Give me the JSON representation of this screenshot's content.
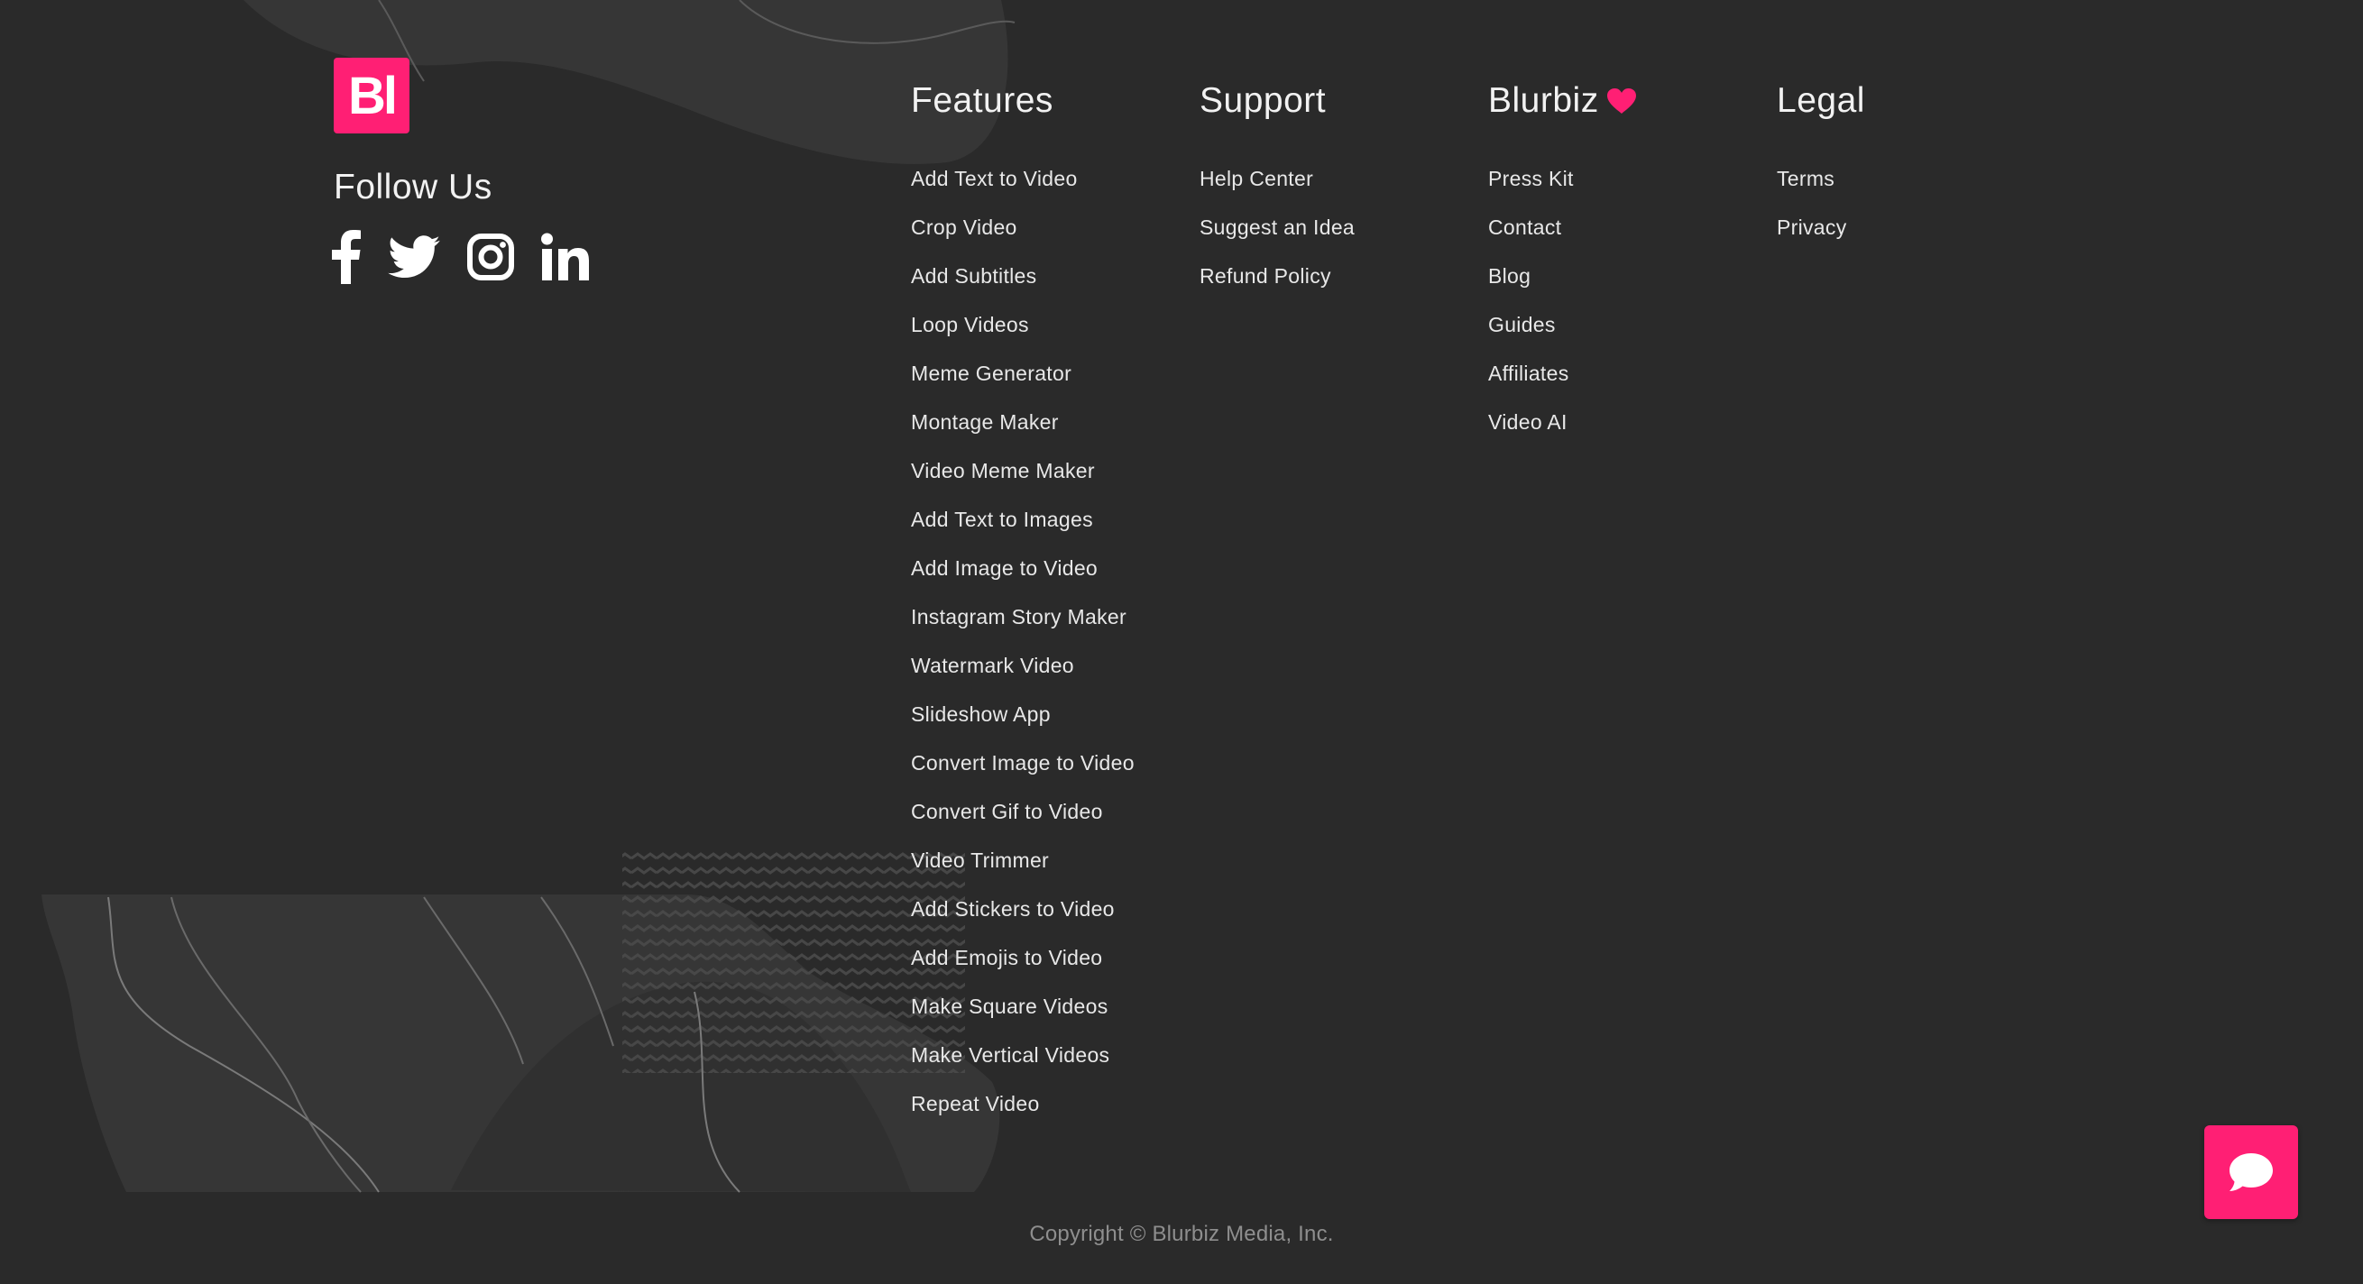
{
  "brand": {
    "logo_text": "Bl",
    "accent": "#ff1f74"
  },
  "follow": {
    "title": "Follow Us",
    "icons": [
      "facebook-icon",
      "twitter-icon",
      "instagram-icon",
      "linkedin-icon"
    ]
  },
  "columns": [
    {
      "title": "Features",
      "links": [
        "Add Text to Video",
        "Crop Video",
        "Add Subtitles",
        "Loop Videos",
        "Meme Generator",
        "Montage Maker",
        "Video Meme Maker",
        "Add Text to Images",
        "Add Image to Video",
        "Instagram Story Maker",
        "Watermark Video",
        "Slideshow App",
        "Convert Image to Video",
        "Convert Gif to Video",
        "Video Trimmer",
        "Add Stickers to Video",
        "Add Emojis to Video",
        "Make Square Videos",
        "Make Vertical Videos",
        "Repeat Video"
      ]
    },
    {
      "title": "Support",
      "links": [
        "Help Center",
        "Suggest an Idea",
        "Refund Policy"
      ]
    },
    {
      "title": "Blurbiz",
      "title_icon": "heart-icon",
      "links": [
        "Press Kit",
        "Contact",
        "Blog",
        "Guides",
        "Affiliates",
        "Video AI"
      ]
    },
    {
      "title": "Legal",
      "links": [
        "Terms",
        "Privacy"
      ]
    }
  ],
  "footer": {
    "copyright": "Copyright © Blurbiz Media, Inc."
  },
  "chat": {
    "icon": "chat-bubble-icon"
  }
}
